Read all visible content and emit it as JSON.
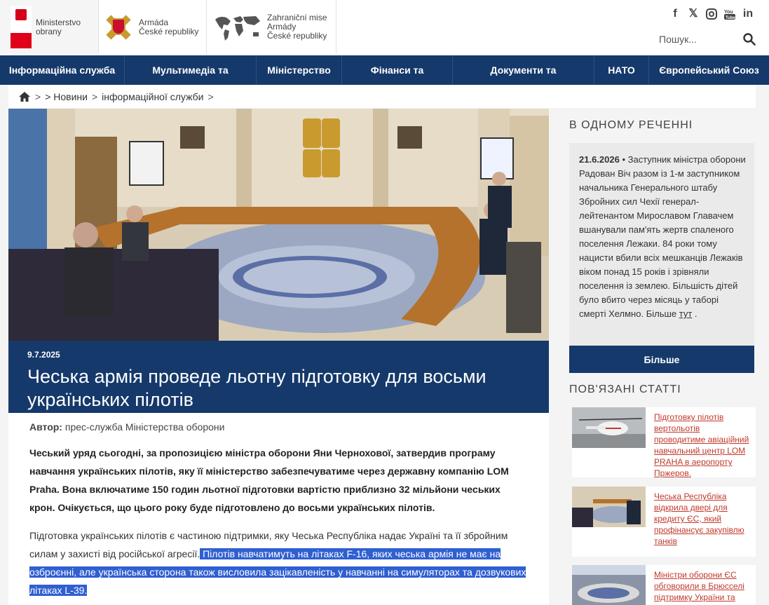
{
  "header": {
    "logo1": {
      "line1": "Ministerstvo",
      "line2": "obrany"
    },
    "logo2": {
      "line1": "Armáda",
      "line2": "České republiky"
    },
    "logo3": {
      "line1": "Zahraniční mise",
      "line2": "Armády",
      "line3": "České republiky"
    },
    "socials": [
      "facebook-icon",
      "x-icon",
      "instagram-icon",
      "youtube-icon",
      "linkedin-icon"
    ],
    "search_placeholder": "Пошук..."
  },
  "nav": [
    "Інформаційна служба",
    "Мультимедіа та",
    "Міністерство",
    "Фінанси та",
    "Документи та",
    "НАТО",
    "Європейський Союз"
  ],
  "breadcrumb": {
    "sep": ">",
    "items": [
      "> Новини",
      "інформаційної служби",
      ">"
    ]
  },
  "article": {
    "date": "9.7.2025",
    "title": "Чеська армія проведе льотну підготовку для восьми українських пілотів",
    "author_label": "Автор:",
    "author": "прес-служба Міністерства оборони",
    "lead": "Чеський уряд сьогодні, за пропозицією міністра оборони Яни Чернохової, затвердив програму навчання українських пілотів, яку її міністерство забезпечуватиме через державну компанію LOM Praha. Вона включатиме 150 годин льотної підготовки вартістю приблизно 32 мільйони чеських крон. Очікується, що цього року буде підготовлено до восьми українських пілотів.",
    "para1_plain": "Підготовка українських пілотів є частиною підтримки, яку Чеська Республіка надає Україні та її збройним силам у захисті від російської агресії.",
    "para1_selected": " Пілотів навчатимуть на літаках F-16, яких чеська армія не має на озброєнні, але українська сторона також висловила зацікавленість у навчанні на симуляторах та дозвукових літаках L-39."
  },
  "sidebar": {
    "sentence_heading": "В ОДНОМУ РЕЧЕННІ",
    "sentence_date": "21.6.2026",
    "sentence_text": " • Заступник міністра оборони Радован Віч разом із 1-м заступником начальника Генерального штабу Збройних сил Чехії генерал-лейтенантом Мирославом Главачем вшанували пам'ять жертв спаленого поселення Лежаки. 84 роки тому нацисти вбили всіх мешканців Лежаків віком понад 15 років і зрівняли поселення із землею. Більшість дітей було вбито через місяць у таборі смерті Хелмно. Більше ",
    "sentence_link": "тут",
    "sentence_end": " .",
    "more_button": "Більше",
    "related_heading": "ПОВ'ЯЗАНІ СТАТТІ",
    "related": [
      {
        "title": "Підготовку пілотів вертольотів проводитиме авіаційний навчальний центр LOM PRAHA в аеропорту Пржеров."
      },
      {
        "title": "Чеська Республіка відкрила двері для кредиту ЄС, який профінансує закупівлю танків"
      },
      {
        "title": "Міністри оборони ЄС обговорили в Брюсселі підтримку України та Білу"
      }
    ]
  },
  "colors": {
    "navy": "#15396b",
    "link_red": "#c0392b",
    "selection": "#2f5fd1"
  }
}
